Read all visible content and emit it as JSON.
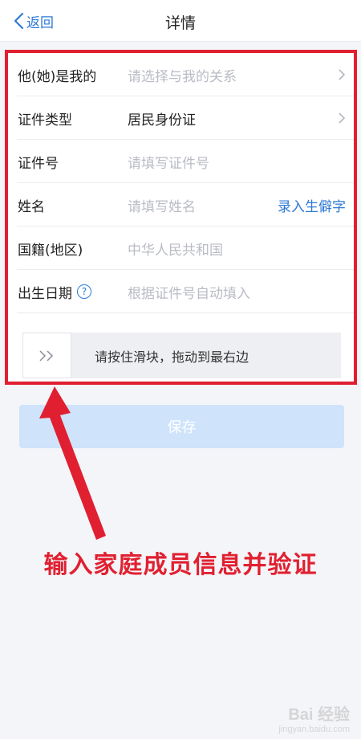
{
  "nav": {
    "back_label": "返回",
    "title": "详情"
  },
  "form": {
    "rows": [
      {
        "label": "他(她)是我的",
        "value": "请选择与我的关系"
      },
      {
        "label": "证件类型",
        "value": "居民身份证"
      },
      {
        "label": "证件号",
        "value": "请填写证件号"
      },
      {
        "label": "姓名",
        "value": "请填写姓名",
        "action": "录入生僻字"
      },
      {
        "label": "国籍(地区)",
        "value": "中华人民共和国"
      },
      {
        "label": "出生日期",
        "value": "根据证件号自动填入"
      }
    ],
    "slider_text": "请按住滑块，拖动到最右边",
    "help_icon_text": "?"
  },
  "save_label": "保存",
  "annotation": "输入家庭成员信息并验证",
  "watermark": {
    "main": "Bai 经验",
    "sub": "jingyan.baidu.com"
  },
  "colors": {
    "accent": "#2d7ad6",
    "annotation": "#e02030",
    "save_button": "#cfe3fb"
  }
}
